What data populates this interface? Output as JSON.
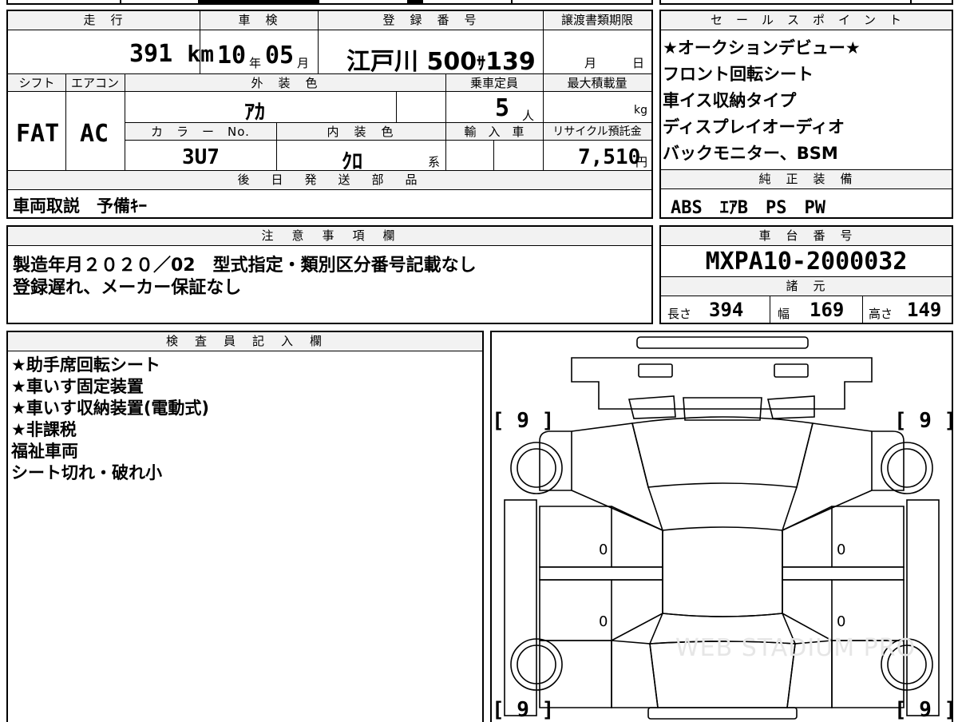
{
  "vehicle": {
    "headers": {
      "mileage": "走　行",
      "inspection": "車　検",
      "reg_number": "登　録　番　号",
      "transfer_deadline": "譲渡書類期限",
      "shift": "シフト",
      "aircon": "エアコン",
      "exterior_color": "外　装　色",
      "capacity": "乗車定員",
      "max_load": "最大積載量",
      "color_no": "カ　ラ　ー　No.",
      "interior_color": "内　装　色",
      "import": "輸　入　車",
      "recycle_fee": "リサイクル預託金",
      "later_parts": "後　日　発　送　部　品"
    },
    "mileage_value": "391",
    "mileage_unit": "km",
    "inspection_year": "10",
    "year_unit": "年",
    "inspection_month": "05",
    "month_unit": "月",
    "reg_area": "江戸川",
    "reg_class": "500",
    "reg_kana": "ｻ",
    "reg_num": "139",
    "deadline_month_unit": "月",
    "deadline_day_unit": "日",
    "shift_value": "FAT",
    "aircon_value": "AC",
    "exterior_color_value": "ｱｶ",
    "capacity_value": "5",
    "capacity_unit": "人",
    "max_load_unit": "kg",
    "color_no_value": "3U7",
    "interior_color_value": "ｸﾛ",
    "interior_color_suffix": "系",
    "recycle_fee_value": "7,510",
    "recycle_fee_unit": "円",
    "later_parts_value": "車両取説　予備ｷｰ"
  },
  "sales_points": {
    "header": "セ　ー　ル　ス　ポ　イ　ン　ト",
    "items": [
      "★オークションデビュー★",
      "フロント回転シート",
      "車イス収納タイプ",
      "ディスプレイオーディオ",
      "バックモニター、BSM"
    ]
  },
  "standard_equipment": {
    "header": "純　正　装　備",
    "value": "ABS　ｴｱB　PS　PW"
  },
  "notes": {
    "header": "注　意　事　項　欄",
    "lines": [
      "製造年月２０２０／02　型式指定・類別区分番号記載なし",
      "登録遅れ、メーカー保証なし"
    ]
  },
  "chassis": {
    "header": "車　台　番　号",
    "value": "MXPA10-2000032"
  },
  "specs": {
    "header": "諸　元",
    "length_label": "長さ",
    "length_value": "394",
    "width_label": "幅",
    "width_value": "169",
    "height_label": "高さ",
    "height_value": "149"
  },
  "inspector": {
    "header": "検　査　員　記　入　欄",
    "items": [
      "★助手席回転シート",
      "★車いす固定装置",
      "★車いす収納装置(電動式)",
      "★非課税",
      "福祉車両",
      "シート切れ・破れ小"
    ]
  },
  "diagram": {
    "tire_fl": "[ 9 ]",
    "tire_fr": "[ 9 ]",
    "tire_rl": "[ 9 ]",
    "tire_rr": "[ 9 ]",
    "door_front_left": "0",
    "door_front_right": "0",
    "door_rear_left": "0",
    "door_rear_right": "0",
    "watermark": "WEB STADIUM PRO"
  }
}
